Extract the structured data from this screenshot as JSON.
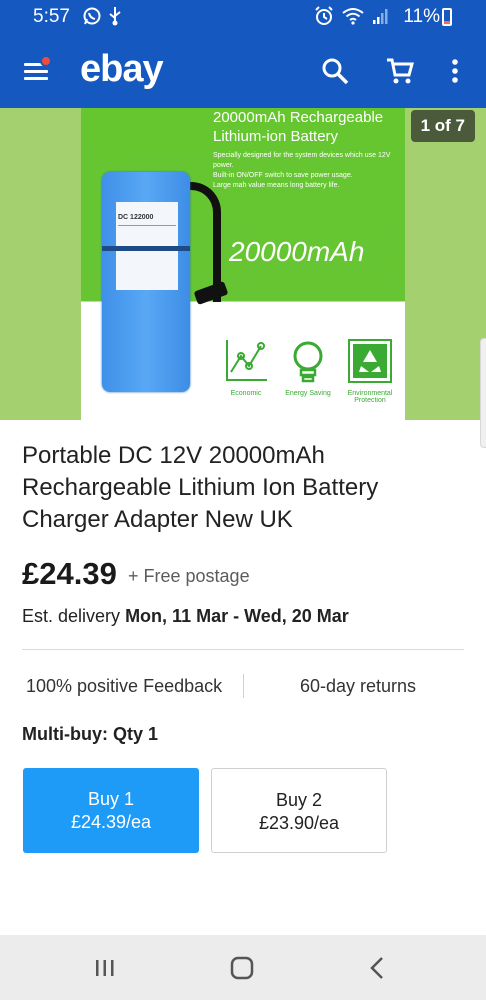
{
  "status_bar": {
    "time": "5:57",
    "battery_percent": "11%",
    "icons": [
      "whatsapp-icon",
      "usb-icon",
      "alarm-icon",
      "wifi-icon",
      "signal-icon",
      "battery-icon"
    ]
  },
  "app_bar": {
    "logo": "ebay",
    "icons": [
      "menu-icon",
      "search-icon",
      "cart-icon",
      "more-icon"
    ],
    "menu_badge_color": "#f24b3a",
    "background_color": "#1558c0"
  },
  "gallery": {
    "counter": "1 of 7",
    "image_title": "20000mAh Rechargeable Lithium-ion Battery",
    "image_description": [
      "Specially designed for the system devices which use 12V power.",
      "Built-in ON/OFF switch to save power usage.",
      "Large mah value means long battery life."
    ],
    "image_capacity": "20000mAh",
    "battery_label_model": "DC 122000",
    "features": [
      "Economic",
      "Energy Saving",
      "Environmental Protection"
    ]
  },
  "listing": {
    "title": "Portable DC 12V 20000mAh Rechargeable Lithium Ion Battery Charger Adapter New UK",
    "price": "£24.39",
    "postage": "+ Free postage",
    "delivery_label": "Est. delivery",
    "delivery_dates": "Mon, 11 Mar - Wed, 20 Mar",
    "feedback": "100% positive Feedback",
    "returns": "60-day returns",
    "multibuy": "Multi-buy: Qty 1"
  },
  "buy_options": [
    {
      "line1": "Buy 1",
      "line2": "£24.39/ea",
      "color": "#1d9bf7"
    },
    {
      "line1": "Buy 2",
      "line2": "£23.90/ea",
      "color": "#ffffff"
    }
  ],
  "nav_bar": {
    "icons": [
      "recent-apps-icon",
      "home-icon",
      "back-icon"
    ]
  }
}
